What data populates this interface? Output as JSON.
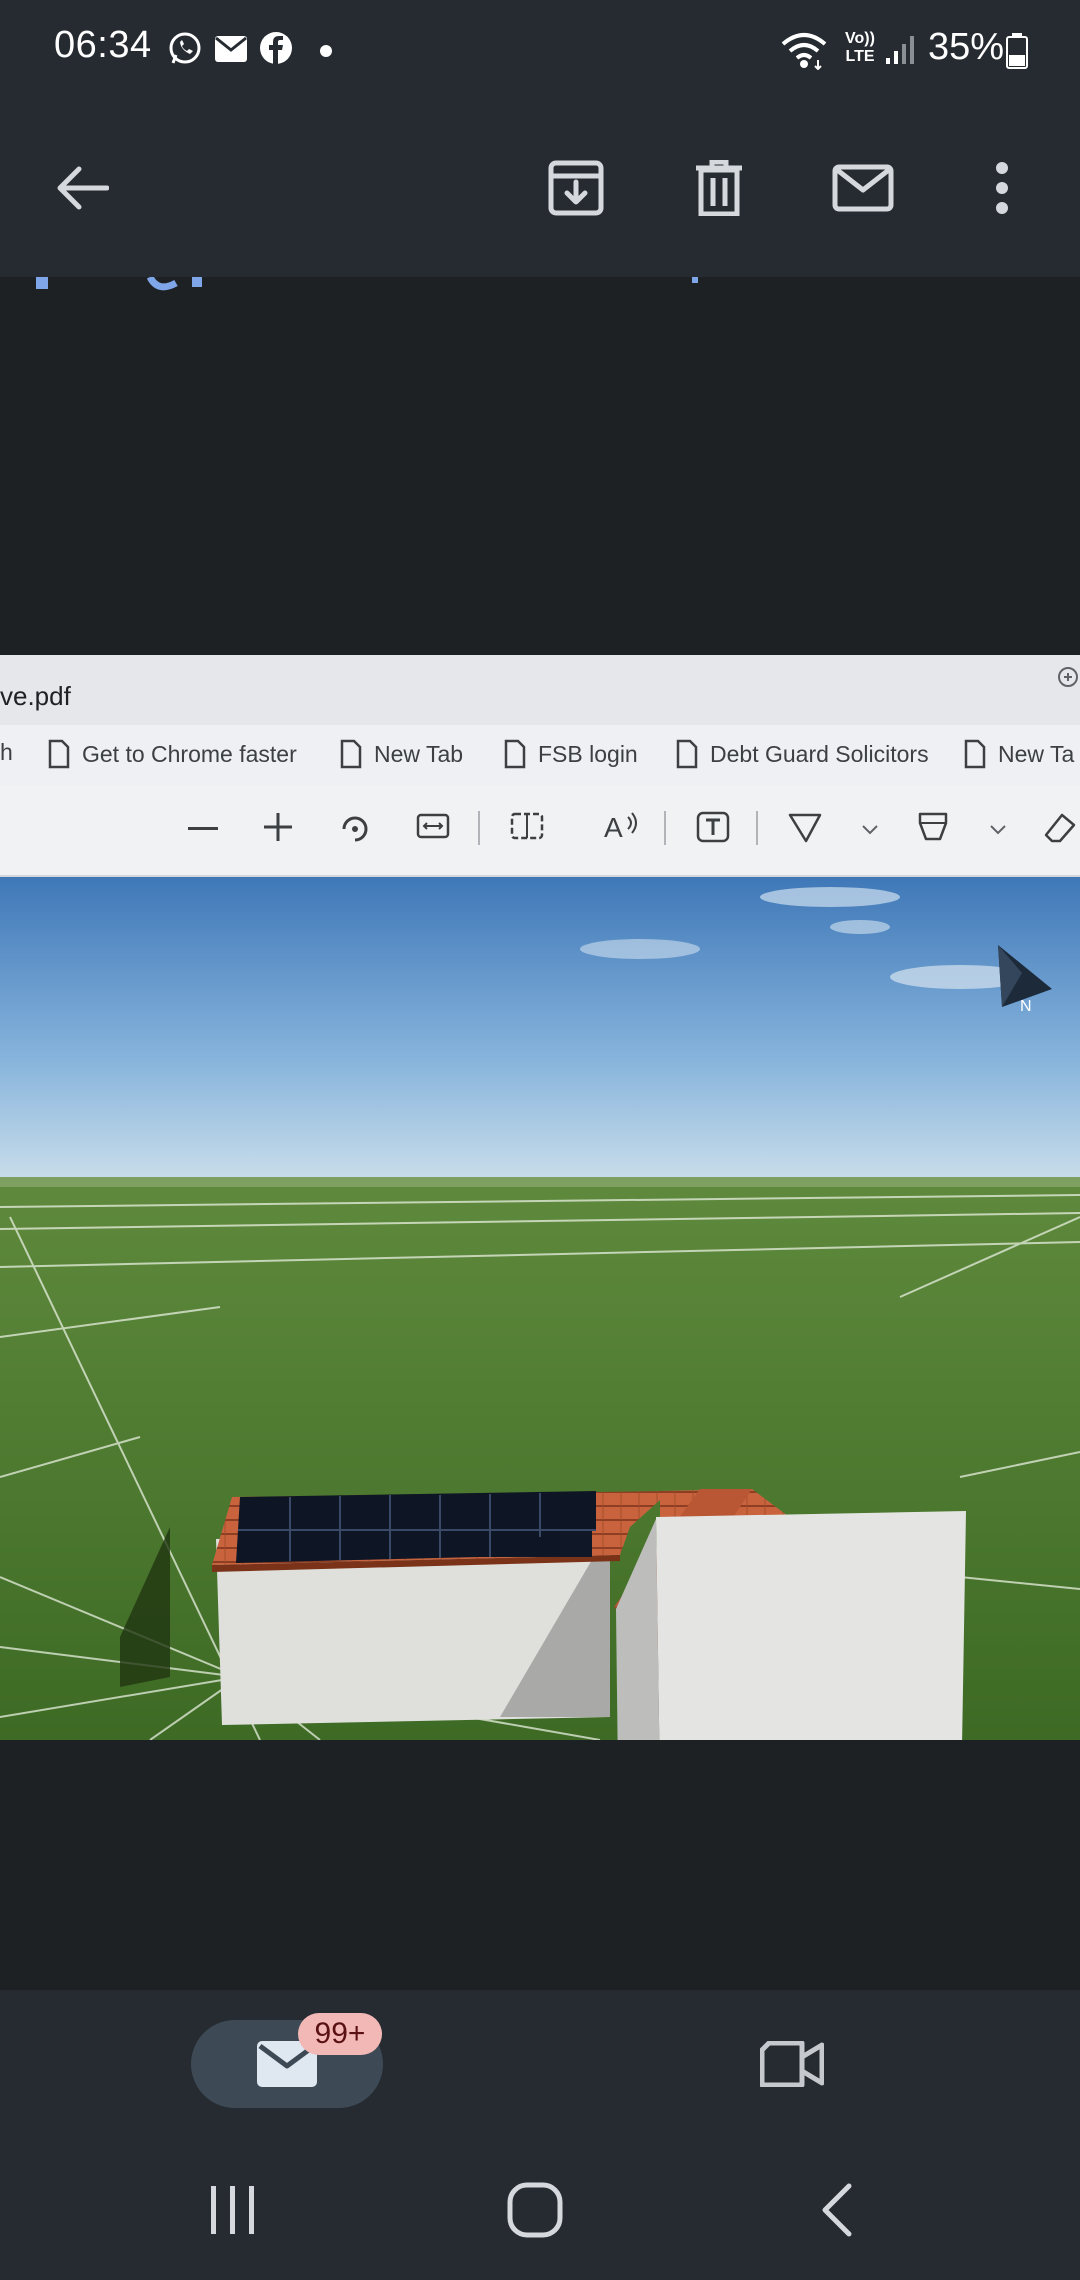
{
  "status_bar": {
    "time": "06:34",
    "notification_icons": [
      "whatsapp-icon",
      "gmail-icon",
      "facebook-icon",
      "dot-icon"
    ],
    "wifi_icon": "wifi-icon",
    "network_label": "Vo)) LTE",
    "network_top": "Vo))",
    "network_bottom": "LTE",
    "battery": "35%"
  },
  "app_bar": {
    "back_icon": "arrow-back-icon",
    "actions": [
      "archive-icon",
      "delete-icon",
      "mark-unread-icon",
      "more-vert-icon"
    ]
  },
  "attachment_photo": {
    "filename": "ve.pdf",
    "bookmarks": [
      {
        "label": "h"
      },
      {
        "label": "Get to Chrome faster"
      },
      {
        "label": "New Tab"
      },
      {
        "label": "FSB login"
      },
      {
        "label": "Debt Guard Solicitors"
      },
      {
        "label": "New Ta"
      }
    ],
    "compass_label": "N"
  },
  "bottom_nav": {
    "mail_badge": "99+",
    "mail_icon": "mail-icon",
    "meet_icon": "video-camera-icon"
  },
  "system_nav": [
    "recents-icon",
    "home-icon",
    "back-icon"
  ],
  "colors": {
    "bar_background": "#252b30",
    "body_background": "#1e2124",
    "badge": "#f2b8b5",
    "pill": "#3d4a56"
  }
}
